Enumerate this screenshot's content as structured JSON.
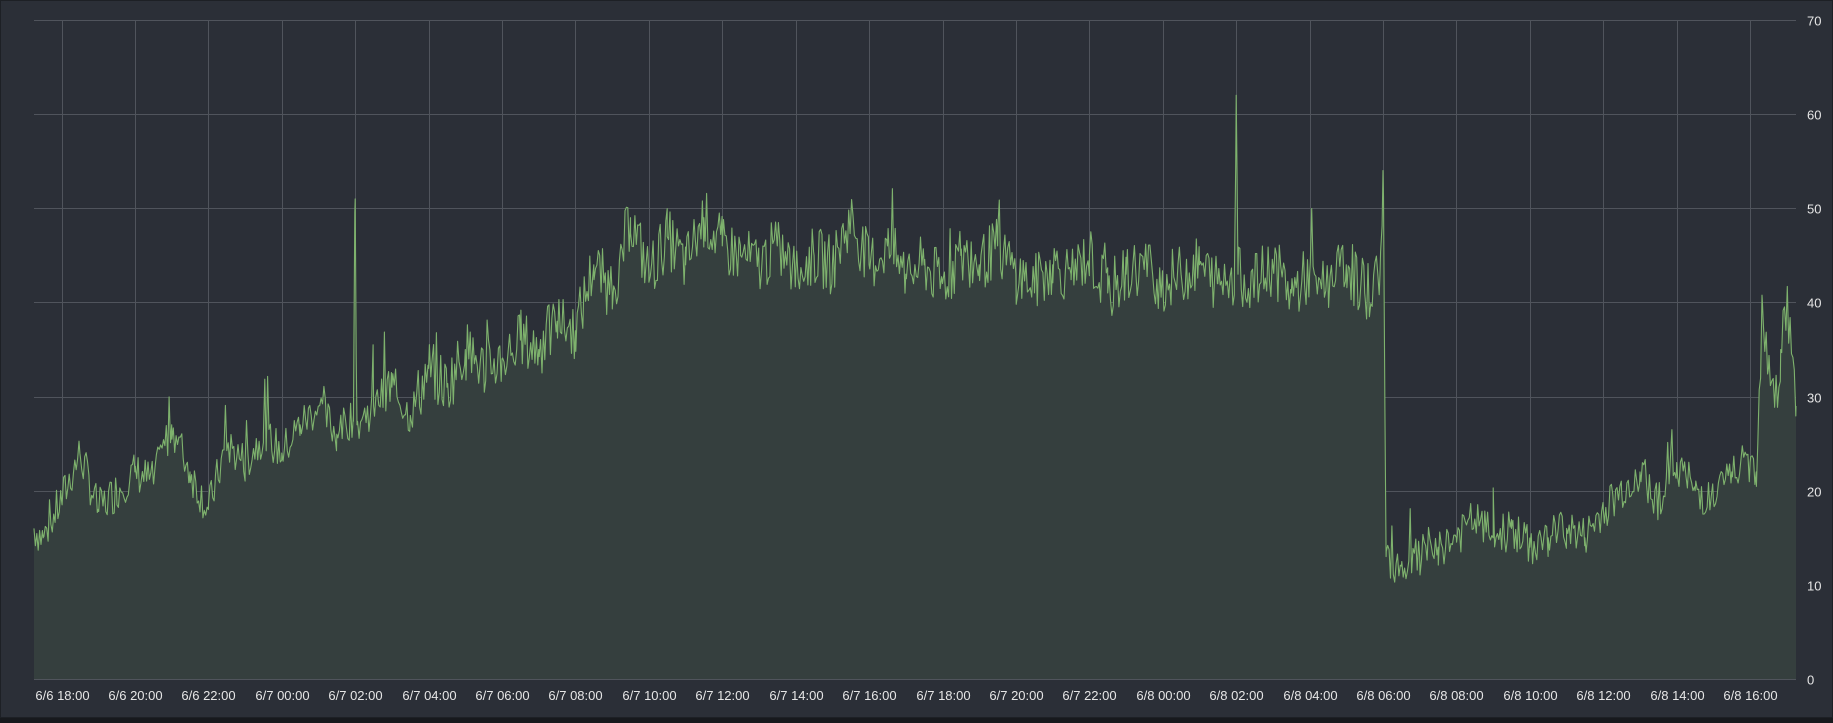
{
  "colors": {
    "background": "#2b2f37",
    "page": "#17191d",
    "grid": "#50545c",
    "line": "#7eb26d",
    "area": "#353f3e",
    "text": "#e6e6e6"
  },
  "chart_data": {
    "type": "area",
    "title": "",
    "xlabel": "",
    "ylabel": "",
    "grid": true,
    "y_axis_position": "right",
    "ylim": [
      0,
      70
    ],
    "y_ticks": [
      "0",
      "10",
      "20",
      "30",
      "40",
      "50",
      "60",
      "70"
    ],
    "x_range": [
      "6/6 17:15",
      "6/8 17:15"
    ],
    "x_tick_times": [
      "6/6 18:00",
      "6/6 20:00",
      "6/6 22:00",
      "6/7 00:00",
      "6/7 02:00",
      "6/7 04:00",
      "6/7 06:00",
      "6/7 08:00",
      "6/7 10:00",
      "6/7 12:00",
      "6/7 14:00",
      "6/7 16:00",
      "6/7 18:00",
      "6/7 20:00",
      "6/7 22:00",
      "6/8 00:00",
      "6/8 02:00",
      "6/8 04:00",
      "6/8 06:00",
      "6/8 08:00",
      "6/8 10:00",
      "6/8 12:00",
      "6/8 14:00",
      "6/8 16:00"
    ],
    "x_tick_labels": [
      "6/6 18:00",
      "6/6 20:00",
      "6/6 22:00",
      "6/7 00:00",
      "6/7 02:00",
      "6/7 04:00",
      "6/7 06:00",
      "6/7 08:00",
      "6/7 10:00",
      "6/7 12:00",
      "6/7 14:00",
      "6/7 16:00",
      "6/7 18:00",
      "6/7 20:00",
      "6/7 22:00",
      "6/8 00:00",
      "6/8 02:00",
      "6/8 04:00",
      "6/8 06:00",
      "6/8 08:00",
      "6/8 10:00",
      "6/8 12:00",
      "6/8 14:00",
      "6/8 16:00"
    ],
    "series": [
      {
        "x": [
          "6/6 17:15",
          "6/6 17:30",
          "6/6 18:00",
          "6/6 18:30",
          "6/6 19:00",
          "6/6 19:30",
          "6/6 20:00",
          "6/6 20:30",
          "6/6 21:00",
          "6/6 21:30",
          "6/6 22:00",
          "6/6 22:30",
          "6/6 23:00",
          "6/6 23:30",
          "6/7 00:00",
          "6/7 00:30",
          "6/7 01:00",
          "6/7 01:30",
          "6/7 01:57",
          "6/7 02:00",
          "6/7 02:03",
          "6/7 02:30",
          "6/7 03:00",
          "6/7 03:30",
          "6/7 04:00",
          "6/7 04:30",
          "6/7 05:00",
          "6/7 05:30",
          "6/7 06:00",
          "6/7 06:30",
          "6/7 07:00",
          "6/7 07:30",
          "6/7 08:00",
          "6/7 08:30",
          "6/7 09:00",
          "6/7 09:30",
          "6/7 10:00",
          "6/7 10:30",
          "6/7 11:00",
          "6/7 11:30",
          "6/7 12:00",
          "6/7 12:30",
          "6/7 13:00",
          "6/7 13:30",
          "6/7 14:00",
          "6/7 14:30",
          "6/7 15:00",
          "6/7 15:30",
          "6/7 16:00",
          "6/7 16:30",
          "6/7 17:00",
          "6/7 17:30",
          "6/7 18:00",
          "6/7 18:30",
          "6/7 19:00",
          "6/7 19:30",
          "6/7 20:00",
          "6/7 20:30",
          "6/7 21:00",
          "6/7 21:30",
          "6/7 22:00",
          "6/7 22:30",
          "6/7 23:00",
          "6/7 23:30",
          "6/8 00:00",
          "6/8 00:30",
          "6/8 01:00",
          "6/8 01:30",
          "6/8 01:57",
          "6/8 02:00",
          "6/8 02:03",
          "6/8 02:30",
          "6/8 03:00",
          "6/8 03:30",
          "6/8 04:00",
          "6/8 04:30",
          "6/8 05:00",
          "6/8 05:30",
          "6/8 05:55",
          "6/8 06:00",
          "6/8 06:05",
          "6/8 06:30",
          "6/8 07:00",
          "6/8 07:30",
          "6/8 08:00",
          "6/8 08:30",
          "6/8 09:00",
          "6/8 09:30",
          "6/8 10:00",
          "6/8 10:30",
          "6/8 11:00",
          "6/8 11:30",
          "6/8 12:00",
          "6/8 12:30",
          "6/8 13:00",
          "6/8 13:30",
          "6/8 14:00",
          "6/8 14:30",
          "6/8 15:00",
          "6/8 15:30",
          "6/8 16:00",
          "6/8 16:10",
          "6/8 16:20",
          "6/8 16:30",
          "6/8 16:40",
          "6/8 16:50",
          "6/8 17:00",
          "6/8 17:15"
        ],
        "values": [
          16,
          15,
          19,
          24,
          18,
          20,
          22,
          21,
          27,
          22,
          18,
          25,
          23,
          26,
          24,
          27,
          29,
          26,
          28,
          51,
          27,
          29,
          31,
          28,
          33,
          31,
          35,
          33,
          34,
          36,
          35,
          38,
          37,
          44,
          41,
          49,
          43,
          47,
          44,
          49,
          46,
          45,
          44,
          46,
          43,
          45,
          44,
          49,
          44,
          46,
          43,
          44,
          42,
          45,
          44,
          46,
          43,
          42,
          44,
          43,
          45,
          41,
          43,
          44,
          42,
          43,
          44,
          42,
          43,
          62,
          43,
          42,
          44,
          41,
          43,
          42,
          44,
          41,
          43,
          54,
          13,
          12,
          13,
          14,
          15,
          17,
          15,
          16,
          14,
          15,
          16,
          15,
          18,
          20,
          22,
          19,
          23,
          20,
          19,
          22,
          23,
          22,
          40,
          33,
          29,
          35,
          40,
          29
        ]
      }
    ]
  }
}
